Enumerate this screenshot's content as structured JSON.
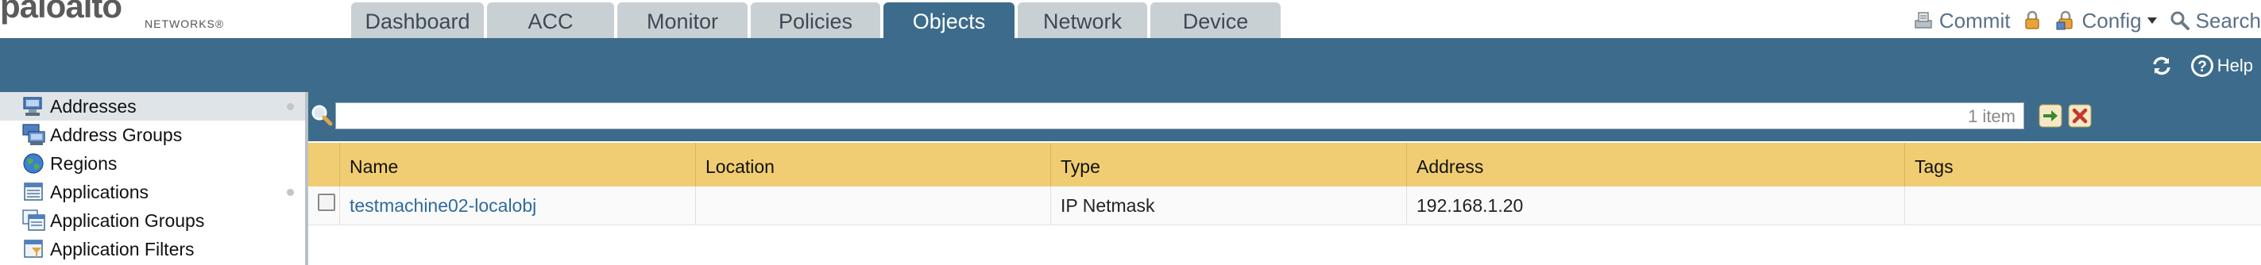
{
  "logo": {
    "text": "paloalto",
    "sub": "NETWORKS®"
  },
  "tabs": [
    {
      "label": "Dashboard"
    },
    {
      "label": "ACC"
    },
    {
      "label": "Monitor"
    },
    {
      "label": "Policies"
    },
    {
      "label": "Objects",
      "active": true
    },
    {
      "label": "Network"
    },
    {
      "label": "Device"
    }
  ],
  "actions": {
    "commit": "Commit",
    "config": "Config",
    "search": "Search"
  },
  "subbar": {
    "help": "Help"
  },
  "sidebar": {
    "items": [
      {
        "label": "Addresses",
        "selected": true
      },
      {
        "label": "Address Groups"
      },
      {
        "label": "Regions"
      },
      {
        "label": "Applications"
      },
      {
        "label": "Application Groups"
      },
      {
        "label": "Application Filters"
      }
    ]
  },
  "filter": {
    "value": "",
    "count": "1 item"
  },
  "table": {
    "columns": [
      "Name",
      "Location",
      "Type",
      "Address",
      "Tags"
    ],
    "rows": [
      {
        "name": "testmachine02-localobj",
        "location": "",
        "type": "IP Netmask",
        "address": "192.168.1.20",
        "tags": ""
      }
    ]
  },
  "colors": {
    "accent": "#3d6b8b",
    "header_row": "#f0cd72",
    "tab_inactive": "#c9d0d3",
    "link": "#2e6a9e"
  }
}
